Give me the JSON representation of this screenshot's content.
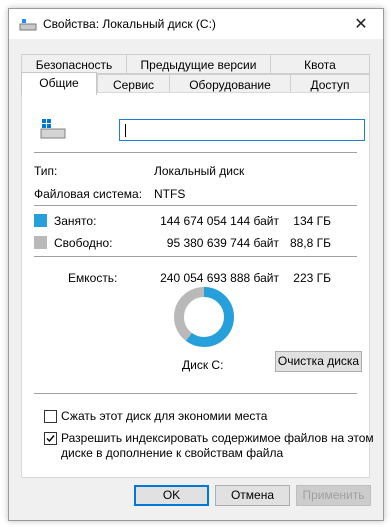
{
  "window": {
    "title": "Свойства: Локальный диск (C:)"
  },
  "tabs_row1": [
    "Безопасность",
    "Предыдущие версии",
    "Квота"
  ],
  "tabs_row2": [
    "Общие",
    "Сервис",
    "Оборудование",
    "Доступ"
  ],
  "active_tab": "Общие",
  "general": {
    "drive_name_value": "",
    "type_label": "Тип:",
    "type_value": "Локальный диск",
    "fs_label": "Файловая система:",
    "fs_value": "NTFS",
    "used_label": "Занято:",
    "used_bytes": "144 674 054 144 байт",
    "used_size": "134 ГБ",
    "free_label": "Свободно:",
    "free_bytes": "95 380 639 744 байт",
    "free_size": "88,8 ГБ",
    "capacity_label": "Емкость:",
    "capacity_bytes": "240 054 693 888 байт",
    "capacity_size": "223 ГБ",
    "disk_label": "Диск C:",
    "cleanup_button": "Очистка диска",
    "compress_checkbox": "Сжать этот диск для экономии места",
    "compress_checked": false,
    "index_checkbox_line1": "Разрешить индексировать содержимое файлов на этом",
    "index_checkbox_line2": "диске в дополнение к свойствам файла",
    "index_checked": true
  },
  "chart_data": {
    "type": "pie",
    "categories": [
      "Занято",
      "Свободно"
    ],
    "values": [
      144674054144,
      95380639744
    ],
    "colors": [
      "#26a0da",
      "#b9b9b9"
    ]
  },
  "buttons": {
    "ok": "OK",
    "cancel": "Отмена",
    "apply": "Применить"
  }
}
